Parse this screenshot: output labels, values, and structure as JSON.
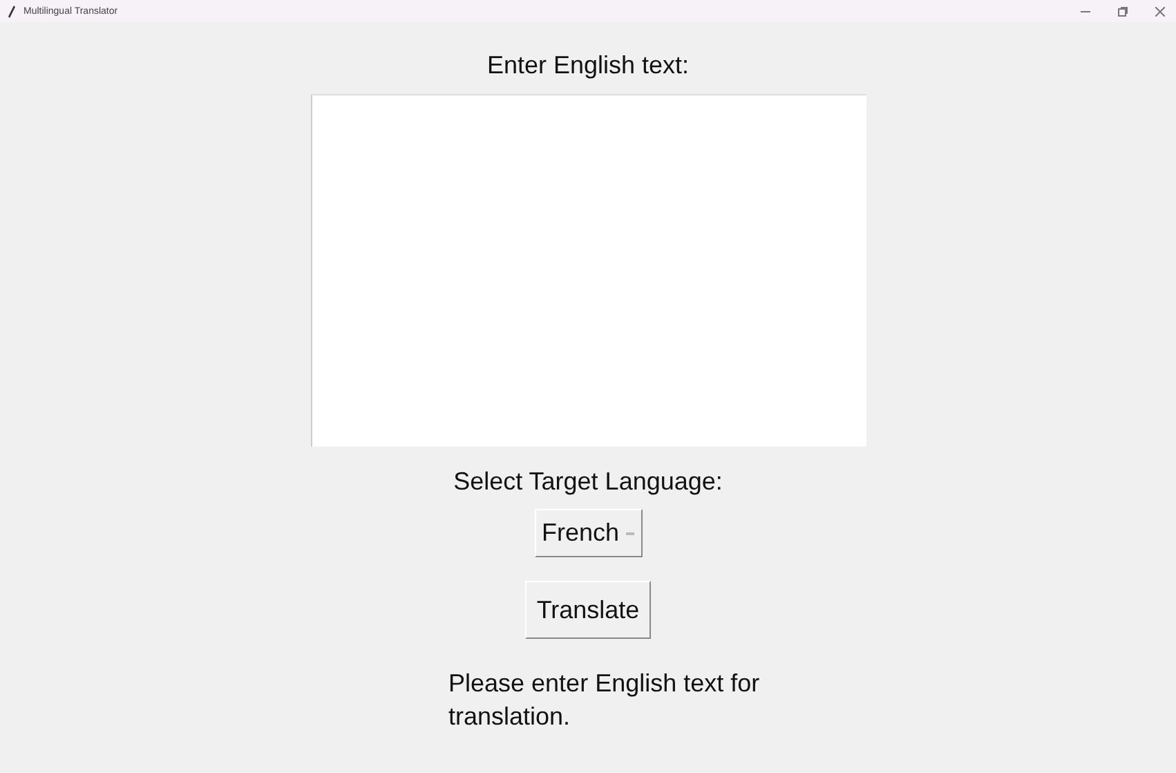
{
  "window": {
    "title": "Multilingual Translator"
  },
  "input_label": "Enter English text:",
  "language_label": "Select Target Language:",
  "language_menu": {
    "value": "French"
  },
  "translate_button": {
    "label": "Translate"
  },
  "status_message": "Please enter English text for translation."
}
